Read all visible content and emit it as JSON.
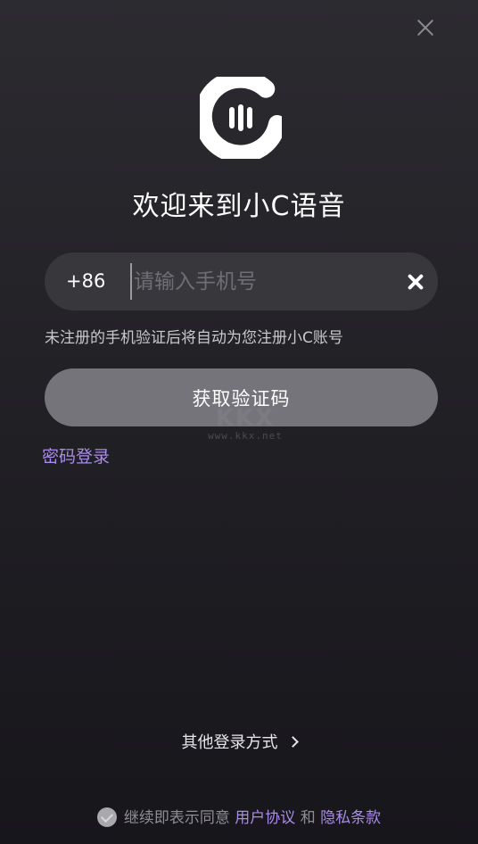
{
  "title": "欢迎来到小C语音",
  "phone": {
    "country_code": "+86",
    "placeholder": "请输入手机号",
    "value": ""
  },
  "hint": "未注册的手机验证后将自动为您注册小C账号",
  "get_code_label": "获取验证码",
  "password_login_label": "密码登录",
  "other_login_label": "其他登录方式",
  "agreement": {
    "prefix": "继续即表示同意",
    "user_agreement": "用户协议",
    "and": "和",
    "privacy_policy": "隐私条款"
  },
  "watermark": {
    "url": "www.kkx.net"
  },
  "colors": {
    "accent": "#a98be8",
    "button": "#75747a",
    "input_bg": "#38373c"
  }
}
